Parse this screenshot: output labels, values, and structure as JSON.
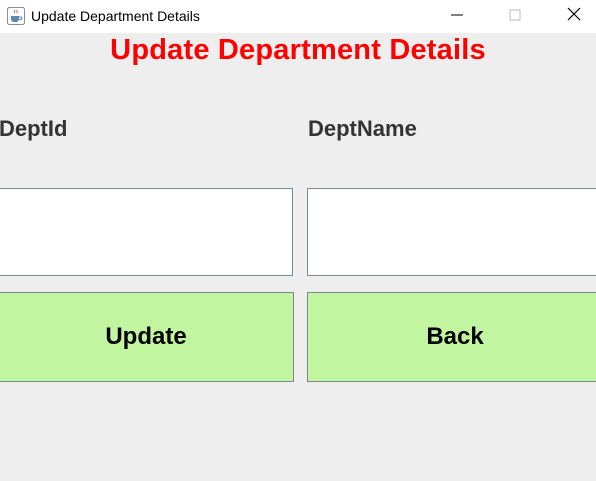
{
  "window": {
    "title": "Update Department Details",
    "icon": "java-cup-icon",
    "controls": {
      "minimize": "minimize-icon",
      "maximize": "maximize-icon",
      "close": "close-icon"
    }
  },
  "form": {
    "heading": "Update Department Details",
    "dept_id_label": "DeptId",
    "dept_name_label": "DeptName",
    "dept_id_value": "",
    "dept_name_value": ""
  },
  "buttons": {
    "update_label": "Update",
    "back_label": "Back"
  },
  "colors": {
    "heading": "#ff0000",
    "button_bg": "#c2f59f",
    "background": "#eeeeee"
  }
}
